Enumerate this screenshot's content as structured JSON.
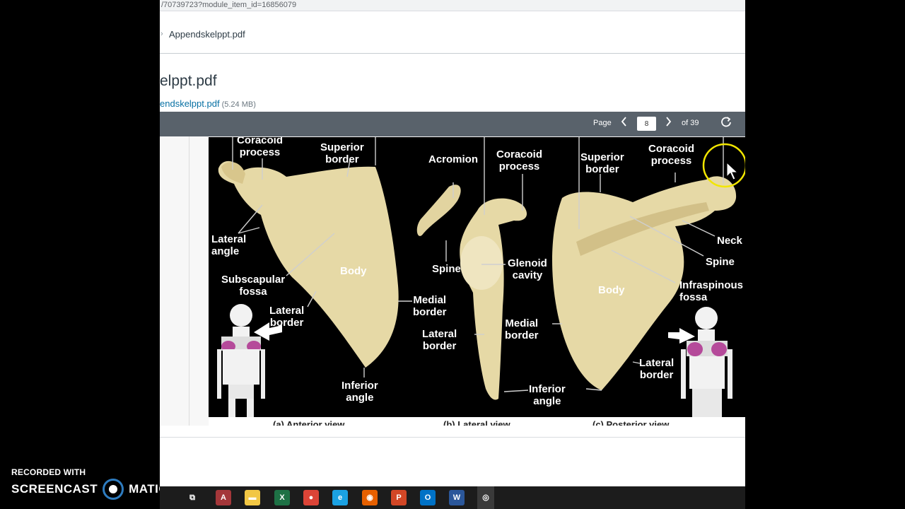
{
  "browser": {
    "url_fragment": "/70739723?module_item_id=16856079"
  },
  "breadcrumb": {
    "separator": "›",
    "current": "Appendskelppt.pdf"
  },
  "file": {
    "title": "elppt.pdf",
    "link_text": "endskelppt.pdf",
    "size": "(5.24 MB)"
  },
  "pdf_toolbar": {
    "page_label": "Page",
    "current_page": "8",
    "of_label": "of 39",
    "prev_icon": "chevron-left-icon",
    "next_icon": "chevron-right-icon",
    "rotate_icon": "rotate-icon"
  },
  "figure": {
    "anterior": {
      "coracoid": "Coracoid\nprocess",
      "superior_border": "Superior\nborder",
      "lateral_angle": "Lateral\nangle",
      "subscapular_fossa": "Subscapular\nfossa",
      "body": "Body",
      "lateral_border": "Lateral\nborder",
      "inferior_angle": "Inferior\nangle",
      "caption": "(a) Anterior view"
    },
    "lateral": {
      "acromion": "Acromion",
      "coracoid": "Coracoid\nprocess",
      "spine": "Spine",
      "glenoid": "Glenoid\ncavity",
      "medial_border": "Medial\nborder",
      "lateral_border": "Lateral\nborder",
      "inferior_angle": "Inferior\nangle",
      "caption": "(b) Lateral view"
    },
    "posterior": {
      "superior_border": "Superior\nborder",
      "coracoid": "Coracoid\nprocess",
      "neck": "Neck",
      "spine": "Spine",
      "infraspinous": "Infraspinous\nfossa",
      "body": "Body",
      "medial_border": "Medial\nborder",
      "lateral_border": "Lateral\nborder",
      "caption": "(c) Posterior view"
    }
  },
  "watermark": {
    "recorded_with": "RECORDED WITH",
    "brand_left": "SCREENCAST",
    "brand_right": "MATIC"
  },
  "taskbar": {
    "apps": [
      {
        "name": "task-view",
        "glyph": "⧉",
        "color": "#1c1c1c"
      },
      {
        "name": "access",
        "glyph": "A",
        "color": "#a4373a"
      },
      {
        "name": "file-explorer",
        "glyph": "▬",
        "color": "#f2c744"
      },
      {
        "name": "excel",
        "glyph": "X",
        "color": "#1e7145"
      },
      {
        "name": "chrome",
        "glyph": "●",
        "color": "#db4437"
      },
      {
        "name": "internet-explorer",
        "glyph": "e",
        "color": "#1ba1e2"
      },
      {
        "name": "firefox",
        "glyph": "◉",
        "color": "#e66000"
      },
      {
        "name": "powerpoint",
        "glyph": "P",
        "color": "#d24726"
      },
      {
        "name": "outlook",
        "glyph": "O",
        "color": "#0072c6"
      },
      {
        "name": "word",
        "glyph": "W",
        "color": "#2b579a"
      },
      {
        "name": "screencast-o-matic",
        "glyph": "◎",
        "color": "#3a3a3a"
      }
    ]
  },
  "colors": {
    "toolbar": "#59626b",
    "link": "#0770a3",
    "bone": "#e8dcae",
    "highlight": "#f2e600"
  }
}
